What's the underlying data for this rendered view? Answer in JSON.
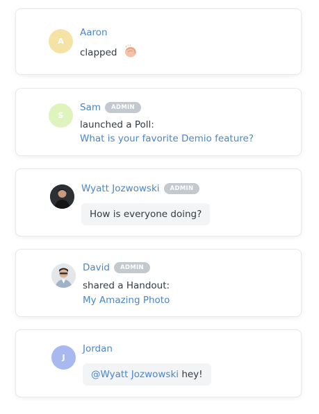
{
  "colors": {
    "link": "#4a86c8",
    "badge": "#c4c9cf",
    "bubble": "#f3f4f6",
    "avatar_aaron": "#f5e3a6",
    "avatar_sam": "#dff3bd",
    "avatar_jordan": "#aab8f0"
  },
  "messages": [
    {
      "initial": "A",
      "name": "Aaron",
      "text": "clapped",
      "icon": "clapping-hands-icon"
    },
    {
      "initial": "S",
      "name": "Sam",
      "badge": "ADMIN",
      "text": "launched a Poll:",
      "link": "What is your favorite Demio feature?"
    },
    {
      "name": "Wyatt Jozwowski",
      "badge": "ADMIN",
      "bubble": "How is everyone doing?",
      "avatar": "photo"
    },
    {
      "name": "David",
      "badge": "ADMIN",
      "text": "shared a Handout:",
      "link": "My Amazing Photo",
      "avatar": "photo"
    },
    {
      "initial": "J",
      "name": "Jordan",
      "mention": "@Wyatt Jozwowski",
      "bubble_rest": " hey!"
    }
  ]
}
